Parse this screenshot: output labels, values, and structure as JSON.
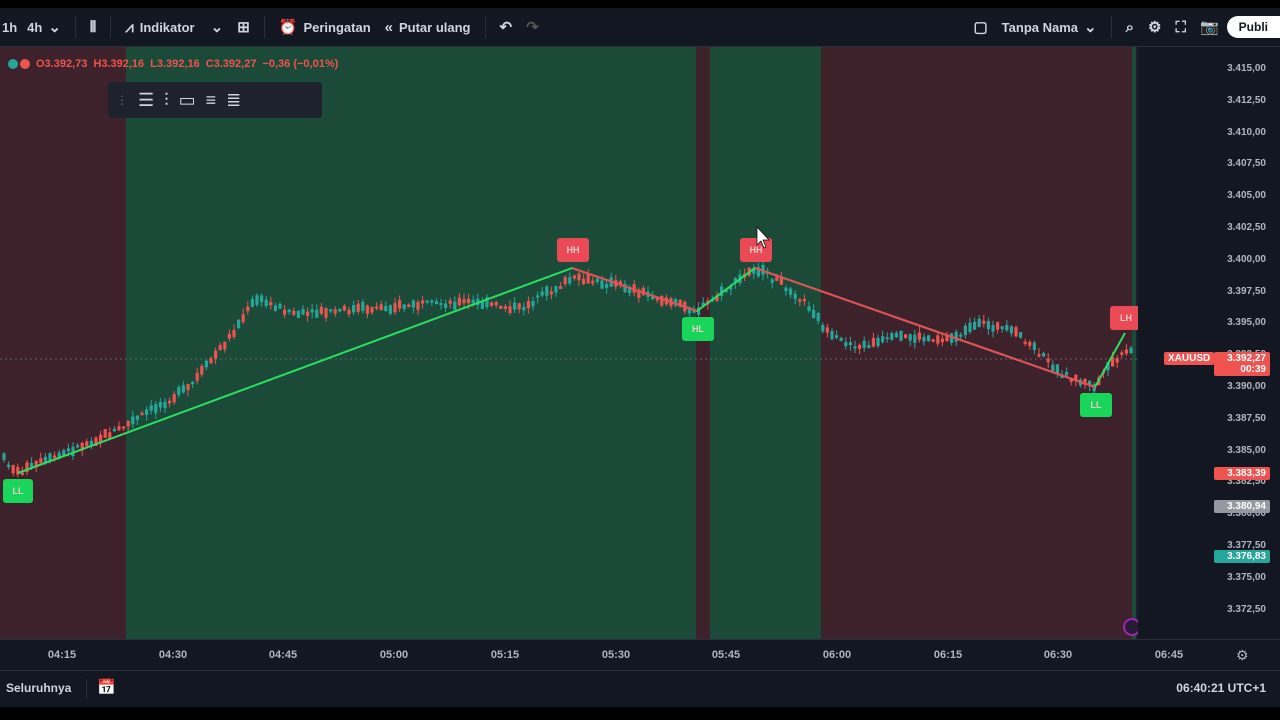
{
  "toolbar": {
    "intervals": [
      "1h",
      "4h"
    ],
    "indicators_label": "Indikator",
    "alerts_label": "Peringatan",
    "replay_label": "Putar ulang",
    "layout_name": "Tanpa Nama",
    "publish_label": "Publi"
  },
  "legend": {
    "open": "O3.392,73",
    "high": "H3.392,16",
    "low": "L3.392,16",
    "close": "C3.392,27",
    "change": "−0,36 (−0,01%)"
  },
  "price_axis": {
    "ticks": [
      "3.415,00",
      "3.412,50",
      "3.410,00",
      "3.407,50",
      "3.405,00",
      "3.402,50",
      "3.400,00",
      "3.397,50",
      "3.395,00",
      "3.392,50",
      "3.390,00",
      "3.387,50",
      "3.385,00",
      "3.382,50",
      "3.380,00",
      "3.377,50",
      "3.375,00",
      "3.372,50"
    ],
    "symbol_label": "XAUUSD",
    "last_price": "3.392,27",
    "countdown": "00:39",
    "label_red": "3.383,39",
    "label_gray": "3.380,94",
    "label_green": "3.376,83"
  },
  "time_axis": {
    "ticks": [
      "04:15",
      "04:30",
      "04:45",
      "05:00",
      "05:15",
      "05:30",
      "05:45",
      "06:00",
      "06:15",
      "06:30",
      "06:45"
    ]
  },
  "swing_labels": {
    "ll": "LL",
    "hh": "HH",
    "hl": "HL",
    "lh": "LH",
    "hh2": "HH",
    "ll2": "LL"
  },
  "bottom": {
    "range_label": "Seluruhnya",
    "clock": "06:40:21 UTC+1"
  },
  "colors": {
    "up": "#26a69a",
    "down": "#ef5350",
    "bull_zone": "#1b4a38",
    "bear_zone": "#3d222b",
    "zigzag_up": "#2cde5f",
    "zigzag_down": "#e94a56"
  }
}
